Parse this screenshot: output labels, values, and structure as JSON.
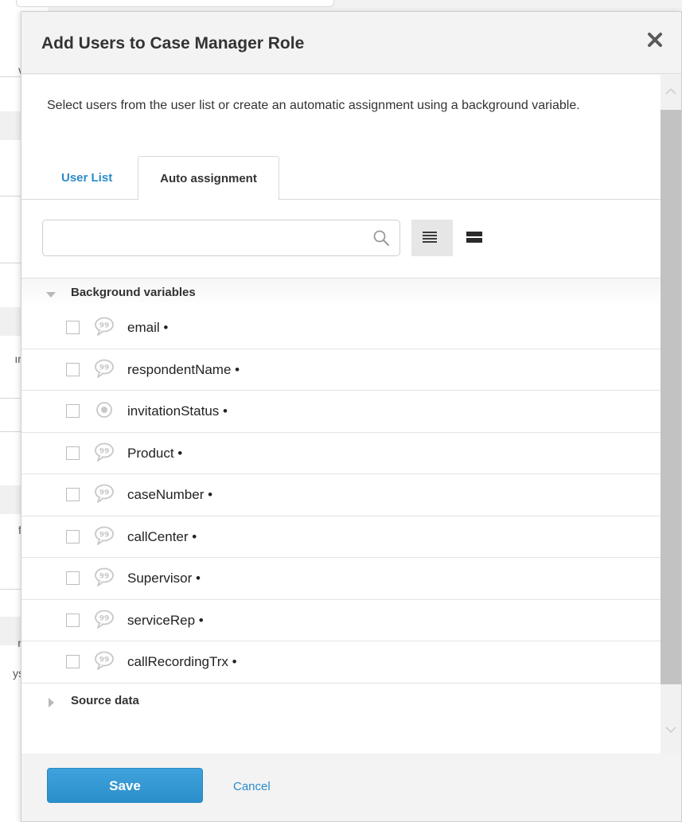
{
  "background": {
    "fragments": [
      "r",
      "v",
      "ın",
      "fi",
      "n",
      "ys"
    ]
  },
  "dialog": {
    "title": "Add Users to Case Manager Role",
    "close_icon": "close-icon",
    "intro": "Select users from the user list or create an automatic assignment using a background variable.",
    "tabs": [
      {
        "label": "User List",
        "active": false
      },
      {
        "label": "Auto assignment",
        "active": true
      }
    ],
    "search": {
      "value": "",
      "placeholder": "",
      "icon": "search-icon"
    },
    "view_toggles": [
      {
        "icon": "list-view-icon",
        "selected": true
      },
      {
        "icon": "compact-view-icon",
        "selected": false
      }
    ],
    "groups": {
      "background": {
        "label": "Background variables",
        "expanded": true,
        "items": [
          {
            "label": "email •",
            "icon": "speech-bubble-icon",
            "checked": false
          },
          {
            "label": "respondentName •",
            "icon": "speech-bubble-icon",
            "checked": false
          },
          {
            "label": "invitationStatus •",
            "icon": "radio-icon",
            "checked": false
          },
          {
            "label": "Product •",
            "icon": "speech-bubble-icon",
            "checked": false
          },
          {
            "label": "caseNumber •",
            "icon": "speech-bubble-icon",
            "checked": false
          },
          {
            "label": "callCenter •",
            "icon": "speech-bubble-icon",
            "checked": false
          },
          {
            "label": "Supervisor •",
            "icon": "speech-bubble-icon",
            "checked": false
          },
          {
            "label": "serviceRep •",
            "icon": "speech-bubble-icon",
            "checked": false
          },
          {
            "label": "callRecordingTrx •",
            "icon": "speech-bubble-icon",
            "checked": false
          }
        ]
      },
      "source": {
        "label": "Source data",
        "expanded": false
      }
    },
    "footer": {
      "save_label": "Save",
      "cancel_label": "Cancel"
    },
    "colors": {
      "accent": "#2b8fcb",
      "link": "#2a8bc9",
      "text": "#333333"
    }
  }
}
